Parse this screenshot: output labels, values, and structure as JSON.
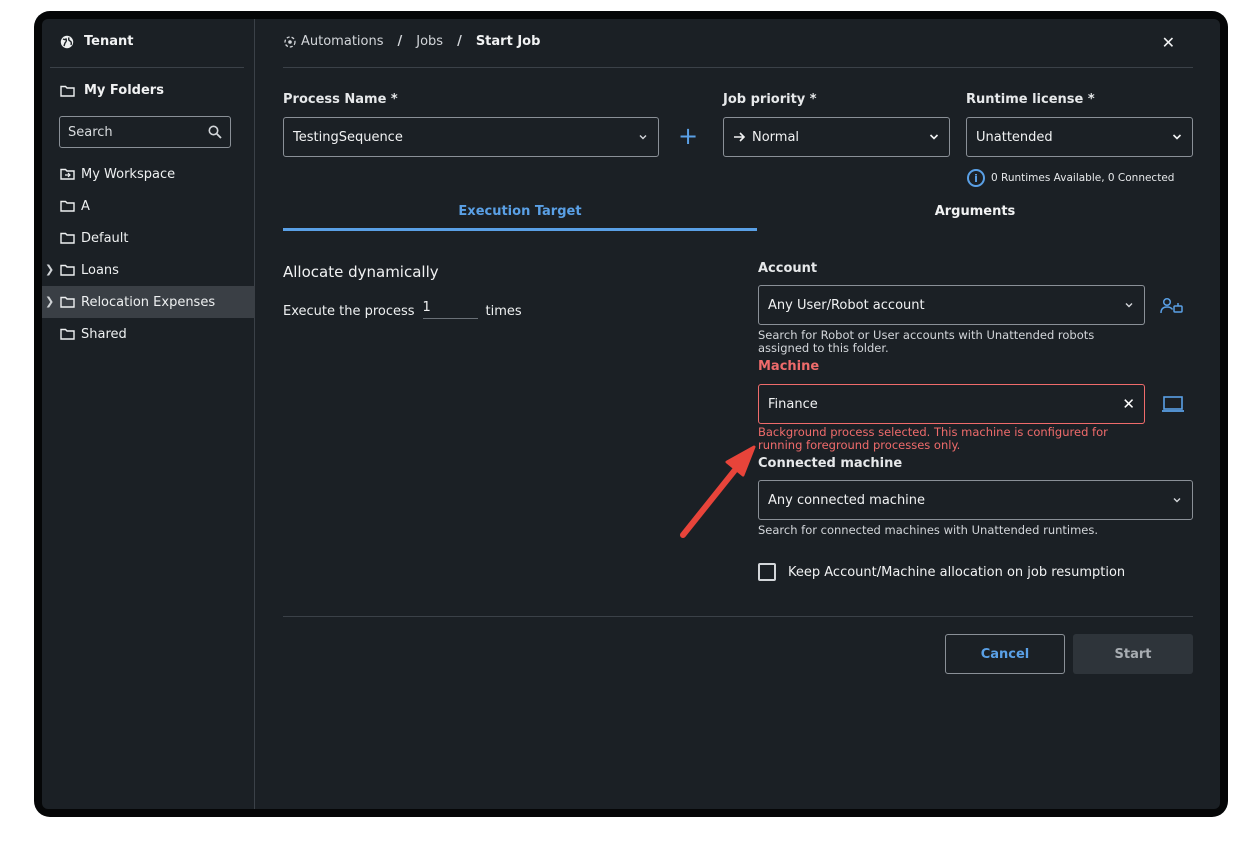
{
  "sidebar": {
    "tenant_label": "Tenant",
    "my_folders_label": "My Folders",
    "search_placeholder": "Search",
    "items": [
      {
        "label": "My Workspace"
      },
      {
        "label": "A"
      },
      {
        "label": "Default"
      },
      {
        "label": "Loans"
      },
      {
        "label": "Relocation Expenses"
      },
      {
        "label": "Shared"
      }
    ]
  },
  "breadcrumb": {
    "root": "Automations",
    "middle": "Jobs",
    "current": "Start Job"
  },
  "form": {
    "process_name_label": "Process Name *",
    "process_name_value": "TestingSequence",
    "job_priority_label": "Job priority *",
    "job_priority_value": "Normal",
    "runtime_license_label": "Runtime license *",
    "runtime_license_value": "Unattended",
    "runtimes_info": "0 Runtimes Available, 0 Connected"
  },
  "tabs": {
    "execution_target": "Execution Target",
    "arguments": "Arguments"
  },
  "execution": {
    "allocate_title": "Allocate dynamically",
    "execute_prefix": "Execute the process",
    "execute_count": "1",
    "execute_suffix": "times"
  },
  "account": {
    "label": "Account",
    "value": "Any User/Robot account",
    "helper_line1": "Search for Robot or User accounts with Unattended robots",
    "helper_line2": "assigned to this folder."
  },
  "machine": {
    "label": "Machine",
    "value": "Finance",
    "error_line1": "Background process selected. This machine is configured for",
    "error_line2": "running foreground processes only."
  },
  "connected_machine": {
    "label": "Connected machine",
    "value": "Any connected machine",
    "helper": "Search for connected machines with Unattended runtimes."
  },
  "checkbox_label": "Keep Account/Machine allocation on job resumption",
  "buttons": {
    "cancel": "Cancel",
    "start": "Start"
  },
  "colors": {
    "accent": "#5aa0e6",
    "error": "#ef6b6b",
    "background": "#1b2025",
    "annotation_arrow": "#e8443a"
  }
}
